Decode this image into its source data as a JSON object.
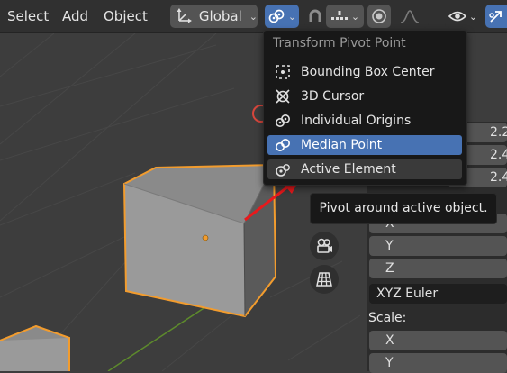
{
  "header": {
    "menus": [
      "Select",
      "Add",
      "Object"
    ],
    "orientation_label": "Global",
    "icons": {
      "orientation": "transform-orientation-icon",
      "pivot": "pivot-individual-origins-icon",
      "snap": "snap-magnet-icon",
      "snap_target": "snap-increment-icon",
      "proportional": "proportional-editing-icon",
      "falloff": "falloff-curve-icon",
      "visibility": "eye-icon",
      "gizmo": "gizmo-icon"
    }
  },
  "pivot_menu": {
    "title": "Transform Pivot Point",
    "items": [
      {
        "label": "Bounding Box Center",
        "icon": "pivot-boundbox-icon",
        "state": "normal"
      },
      {
        "label": "3D Cursor",
        "icon": "pivot-cursor-icon",
        "state": "normal"
      },
      {
        "label": "Individual Origins",
        "icon": "pivot-individual-icon",
        "state": "normal"
      },
      {
        "label": "Median Point",
        "icon": "pivot-median-icon",
        "state": "selected"
      },
      {
        "label": "Active Element",
        "icon": "pivot-active-icon",
        "state": "hovered"
      }
    ]
  },
  "tooltip": {
    "text": "Pivot around active object."
  },
  "properties": {
    "location_values": [
      "2.2",
      "2.4",
      "2.4"
    ],
    "rotation_axes": [
      "X",
      "Y",
      "Z"
    ],
    "rotation_mode": "XYZ Euler",
    "scale_label": "Scale:",
    "scale_axes": [
      "X",
      "Y"
    ]
  },
  "colors": {
    "accent": "#4772b3",
    "selection_outline": "#f29c2e",
    "annotation_arrow": "#e8191c"
  }
}
